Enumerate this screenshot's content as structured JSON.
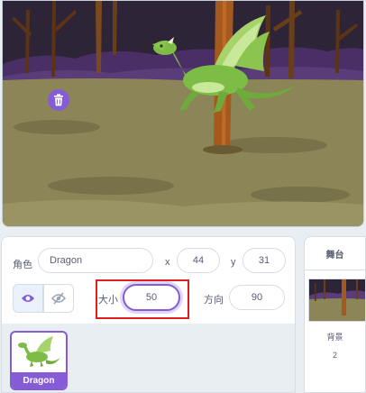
{
  "sprite_info": {
    "sprite_label": "角色",
    "sprite_name": "Dragon",
    "x_label": "x",
    "x_value": "44",
    "y_label": "y",
    "y_value": "31",
    "size_label": "大小",
    "size_value": "50",
    "direction_label": "方向",
    "direction_value": "90"
  },
  "sprite_list": {
    "items": [
      {
        "name": "Dragon"
      }
    ]
  },
  "stage_panel": {
    "title": "舞台",
    "backdrops_label": "背景",
    "backdrops_count": "2"
  },
  "colors": {
    "accent": "#855cd6",
    "highlight": "#e02020",
    "text": "#575e75"
  }
}
